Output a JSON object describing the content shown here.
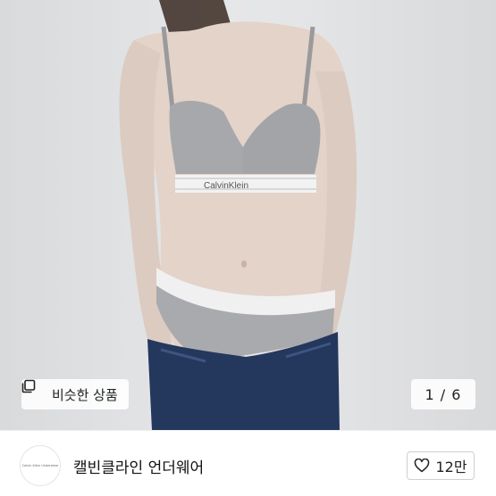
{
  "gallery": {
    "similar_button_label": "비슷한 상품",
    "page_current": "1",
    "page_total": "6",
    "band_text": "CalvinKlein"
  },
  "seller": {
    "logo_text": "Calvin Klein Underwear"
  },
  "product": {
    "title": "캘빈클라인 언더웨어",
    "like_count": "12만"
  },
  "icons": {
    "similar": "copy-stack-icon",
    "like": "heart-outline-icon"
  }
}
